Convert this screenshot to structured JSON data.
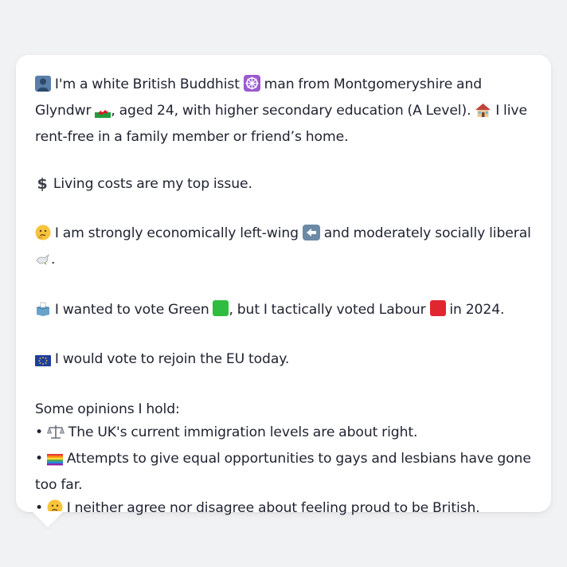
{
  "colors": {
    "background": "#f1f2f4",
    "bubble": "#ffffff",
    "text": "#1f2230",
    "green": "#2fbd3f",
    "red": "#e0272f"
  },
  "profile": {
    "identity": {
      "icon": "person-silhouette-icon",
      "t1": "I'm a white British Buddhist",
      "icon2": "dharma-wheel-icon",
      "t2": "man from Montgomeryshire and Glyndwr",
      "icon3": "wales-flag-icon",
      "t3": ", aged 24, with higher secondary education (A Level).",
      "icon4": "house-icon",
      "t4": "I live rent-free in a family member or friend’s home."
    },
    "issue": {
      "icon": "dollar-sign-icon",
      "text": "Living costs are my top issue."
    },
    "ideology": {
      "icon": "thinking-face-icon",
      "t1": "I am strongly economically left-wing",
      "icon2": "left-arrow-icon",
      "t2": "and moderately socially liberal",
      "icon3": "dove-icon",
      "t3": "."
    },
    "vote": {
      "icon": "ballot-box-icon",
      "t1": "I wanted to vote Green",
      "icon2": "green-square-icon",
      "t2": ", but I tactically voted Labour",
      "icon3": "red-square-icon",
      "t3": "in 2024."
    },
    "eu": {
      "icon": "eu-flag-icon",
      "text": "I would vote to rejoin the EU today."
    },
    "opinions": {
      "heading": "Some opinions I hold:",
      "bullet": "•",
      "items": [
        {
          "icon": "balance-scale-icon",
          "text": "The UK's current immigration levels are about right."
        },
        {
          "icon": "rainbow-flag-icon",
          "text": "Attempts to give equal opportunities to gays and lesbians have gone too far."
        },
        {
          "icon": "thinking-face-icon",
          "text": "I neither agree nor disagree about feeling proud to be British."
        }
      ]
    }
  }
}
